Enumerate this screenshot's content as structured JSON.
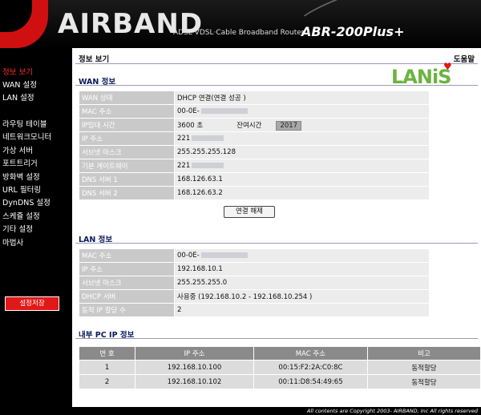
{
  "header": {
    "logo": "AIRBAND",
    "tagline": "ADSL·VDSL·Cable Broadband Router",
    "model": "ABR-200Plus+"
  },
  "sidebar": {
    "items": [
      {
        "label": "정보 보기",
        "active": true
      },
      {
        "label": "WAN 설정"
      },
      {
        "label": "LAN 설정"
      },
      {
        "label": "라우팅 테이블"
      },
      {
        "label": "네트워크모니터"
      },
      {
        "label": "가상 서버"
      },
      {
        "label": "포트트리거"
      },
      {
        "label": "방화벽 설정"
      },
      {
        "label": "URL 필터링"
      },
      {
        "label": "DynDNS 설정"
      },
      {
        "label": "스케쥴 설정"
      },
      {
        "label": "기타 설정"
      },
      {
        "label": "마법사"
      }
    ],
    "save_label": "설정저장"
  },
  "main": {
    "page_title": "정보 보기",
    "help_label": "도움말",
    "watermark": "LANiS"
  },
  "wan": {
    "title": "WAN 정보",
    "rows": [
      {
        "label": "WAN 상태",
        "value": "DHCP 연결(연결 성공 )"
      },
      {
        "label": "MAC 주소",
        "value": "00-0E-"
      },
      {
        "label": "IP임대 시간",
        "value": "3600 초",
        "remain_label": "잔여시간",
        "remain_value": "2017"
      },
      {
        "label": "IP 주소",
        "value": "221"
      },
      {
        "label": "서브넷 마스크",
        "value": "255.255.255.128"
      },
      {
        "label": "기본 게이트웨이",
        "value": "221"
      },
      {
        "label": "DNS 서버 1",
        "value": "168.126.63.1"
      },
      {
        "label": "DNS 서버 2",
        "value": "168.126.63.2"
      }
    ],
    "disconnect_label": "연결 해제"
  },
  "lan": {
    "title": "LAN 정보",
    "rows": [
      {
        "label": "MAC 주소",
        "value": "00-0E-"
      },
      {
        "label": "IP 주소",
        "value": "192.168.10.1"
      },
      {
        "label": "서브넷 마스크",
        "value": "255.255.255.0"
      },
      {
        "label": "DHCP 서버",
        "value": "사용중 (192.168.10.2 - 192.168.10.254 )"
      },
      {
        "label": "동적 IP 할당 수",
        "value": "2"
      }
    ]
  },
  "pc": {
    "title": "내부 PC IP 정보",
    "headers": [
      "번 호",
      "IP 주소",
      "MAC 주소",
      "비고"
    ],
    "rows": [
      [
        "1",
        "192.168.10.100",
        "00:15:F2:2A:C0:8C",
        "동적할당"
      ],
      [
        "2",
        "192.168.10.102",
        "00:11:D8:54:49:65",
        "동적할당"
      ]
    ]
  },
  "footer": {
    "copyright": "All contents are Copyright 2003- AIRBAND, Inc All rights reserved"
  },
  "colors": {
    "accent_red": "#e01818",
    "section_title": "#0b1a5c",
    "label_bg": "#c9c9c9",
    "value_bg": "#ececec",
    "watermark_green": "#6cb33f"
  }
}
